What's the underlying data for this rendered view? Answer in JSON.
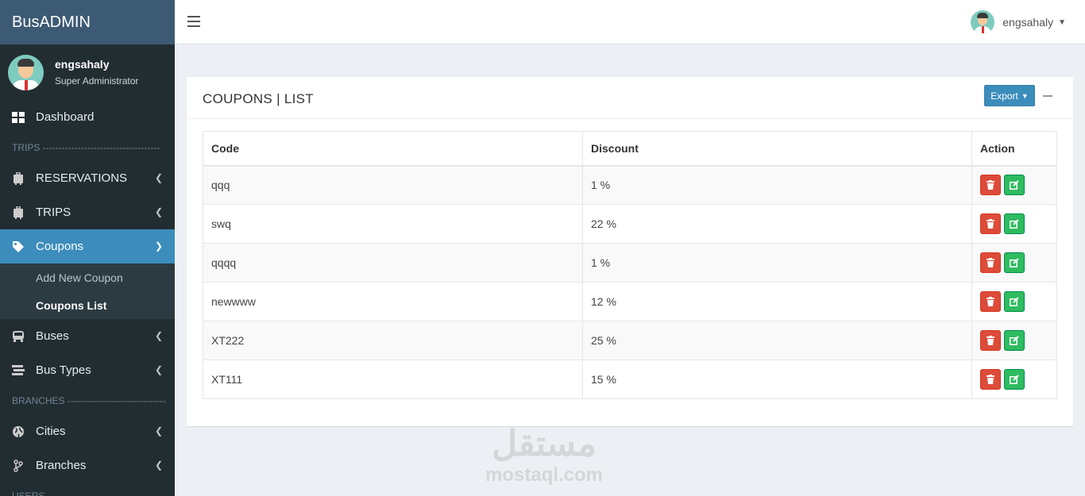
{
  "brand": "BusADMIN",
  "user": {
    "name": "engsahaly",
    "role": "Super Administrator"
  },
  "sidebar": {
    "dashboard": "Dashboard",
    "trips_header": "TRIPS -------------------------------------",
    "reservations": "RESERVATIONS",
    "trips": "TRIPS",
    "coupons": "Coupons",
    "coupons_sub": [
      "Add New Coupon",
      "Coupons List"
    ],
    "buses": "Buses",
    "bus_types": "Bus Types",
    "branches_header": "BRANCHES -------------------------------",
    "cities": "Cities",
    "branches": "Branches",
    "users_header": "USERS"
  },
  "topbar": {
    "username": "engsahaly"
  },
  "box": {
    "title": "COUPONS | LIST",
    "export_label": "Export"
  },
  "table": {
    "headers": [
      "Code",
      "Discount",
      "Action"
    ],
    "rows": [
      {
        "code": "qqq",
        "discount": "1 %"
      },
      {
        "code": "swq",
        "discount": "22 %"
      },
      {
        "code": "qqqq",
        "discount": "1 %"
      },
      {
        "code": "newwww",
        "discount": "12 %"
      },
      {
        "code": "XT222",
        "discount": "25 %"
      },
      {
        "code": "XT111",
        "discount": "15 %"
      }
    ]
  },
  "watermark": {
    "arabic": "مستقل",
    "latin": "mostaql.com"
  },
  "colors": {
    "sidebar": "#222d32",
    "active": "#3c8dbc",
    "danger": "#dd4b39",
    "success": "#2fbb60"
  }
}
